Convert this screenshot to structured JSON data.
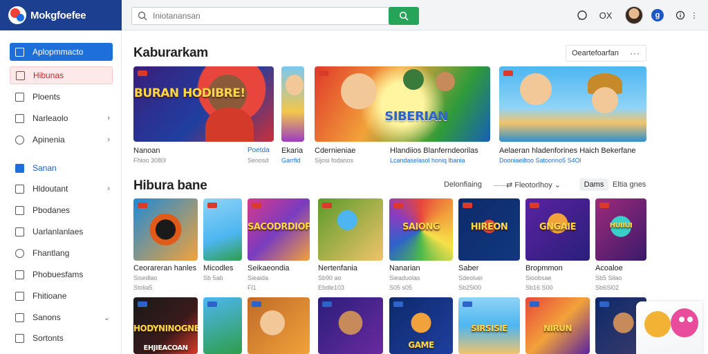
{
  "app": {
    "logo_text": "Mokgfoefee"
  },
  "search": {
    "placeholder": "Iniotanansan",
    "value": ""
  },
  "header_icons": [
    "chat-icon",
    "ox-icon",
    "avatar",
    "g-badge",
    "info-icon"
  ],
  "header": {
    "ox_label": "OX",
    "badge_letter": "g"
  },
  "sidebar": {
    "items": [
      {
        "label": "Aplopmmacto",
        "icon": "app-icon",
        "state": "active"
      },
      {
        "label": "Hibunas",
        "icon": "home-icon",
        "state": "hilite"
      },
      {
        "label": "Ploents",
        "icon": "square-icon"
      },
      {
        "label": "Narleaolo",
        "icon": "k-icon",
        "chevron": "›"
      },
      {
        "label": "Apinenia",
        "icon": "pin-icon",
        "chevron": "›"
      },
      {
        "label": "Sanan",
        "icon": "blue-square-icon",
        "state": "blue"
      },
      {
        "label": "Hldoutant",
        "icon": "list-icon",
        "chevron": "›"
      },
      {
        "label": "Pbodanes",
        "icon": "v-icon"
      },
      {
        "label": "Uarlanlanlaes",
        "icon": "shield-icon"
      },
      {
        "label": "Fhantlang",
        "icon": "circle-icon"
      },
      {
        "label": "Phobuesfams",
        "icon": "monitor-icon"
      },
      {
        "label": "Fhitioane",
        "icon": "bell-icon"
      },
      {
        "label": "Sanons",
        "icon": "gear-icon",
        "chevron": "⌄"
      },
      {
        "label": "Sortonts",
        "icon": "grid-icon"
      }
    ]
  },
  "section1": {
    "title": "Kaburarkam",
    "dropdown_label": "Oeartefoarfan",
    "cards": [
      {
        "title": "Nanoan",
        "subtitle": "Fhioo 3080l",
        "blue_title": "Poetda",
        "blue_sub": "Senosd",
        "art_text": "HIBURAN HODIBRE!"
      },
      {
        "title": "Ekaria",
        "subtitle": "Garrfid",
        "art_text": ""
      },
      {
        "title": "Cdernieniae",
        "subtitle": "Sijosi fodanos",
        "art_text": "SIBERIAN"
      },
      {
        "title": "Hlandiios Blanferndeorilas",
        "subtitle": "Lcandaselasol honiq lbania",
        "art_text": ""
      },
      {
        "title": "Aelaeran hladenforines Haich Bekerfane",
        "subtitle": "Dooniaeiltoo Satoonno5 S4Ol",
        "art_text": ""
      }
    ]
  },
  "section2": {
    "title": "Hibura bane",
    "filter_label": "Delonfiaing",
    "sort_label": "Fleotorlhoy",
    "pill_label": "Dams",
    "view_label": "Eltia gnes",
    "row1": [
      {
        "title": "Ceorareran hanles",
        "sub1": "Sisedlao",
        "sub2": "Stolia5",
        "art_text": ""
      },
      {
        "title": "Micodles",
        "sub1": "Sb 5ab",
        "sub2": "",
        "art_text": ""
      },
      {
        "title": "Seikaeondia",
        "sub1": "Sieaida",
        "sub2": "Fl1",
        "art_text": "SACODRDIOP!"
      },
      {
        "title": "Nertenfania",
        "sub1": "Sb90 ao",
        "sub2": "Ebdle103",
        "art_text": ""
      },
      {
        "title": "Nanarian",
        "sub1": "Sieaduolas",
        "sub2": "S05 s05",
        "art_text": "SAIONG"
      },
      {
        "title": "Saber",
        "sub1": "Sdeoluei",
        "sub2": "Sb25l00",
        "art_text": "HIREON"
      },
      {
        "title": "Bropmmon",
        "sub1": "Sioobsae",
        "sub2": "Sb16 S00",
        "art_text": "GNGAIE"
      },
      {
        "title": "Acoaloe",
        "sub1": "Sb5 Silao",
        "sub2": "Sb6Sl02",
        "art_text": "HUIIUI"
      }
    ],
    "row2": [
      {
        "title": "",
        "art_text": "HODYNINOGNE!"
      },
      {
        "title": "",
        "art_text": ""
      },
      {
        "title": "",
        "art_text": ""
      },
      {
        "title": "",
        "art_text": ""
      },
      {
        "title": "",
        "art_text": "GAME"
      },
      {
        "title": "",
        "art_text": "SIRSISIE"
      },
      {
        "title": "",
        "art_text": "NIRUN"
      },
      {
        "title": "",
        "art_text": ""
      }
    ],
    "row2_caption": "EHJIEACOAN"
  },
  "colors": {
    "header_blue": "#1d3f8f",
    "accent_blue": "#1e6fd9",
    "search_green": "#26a55a",
    "hilite_red": "#c42a2a"
  }
}
